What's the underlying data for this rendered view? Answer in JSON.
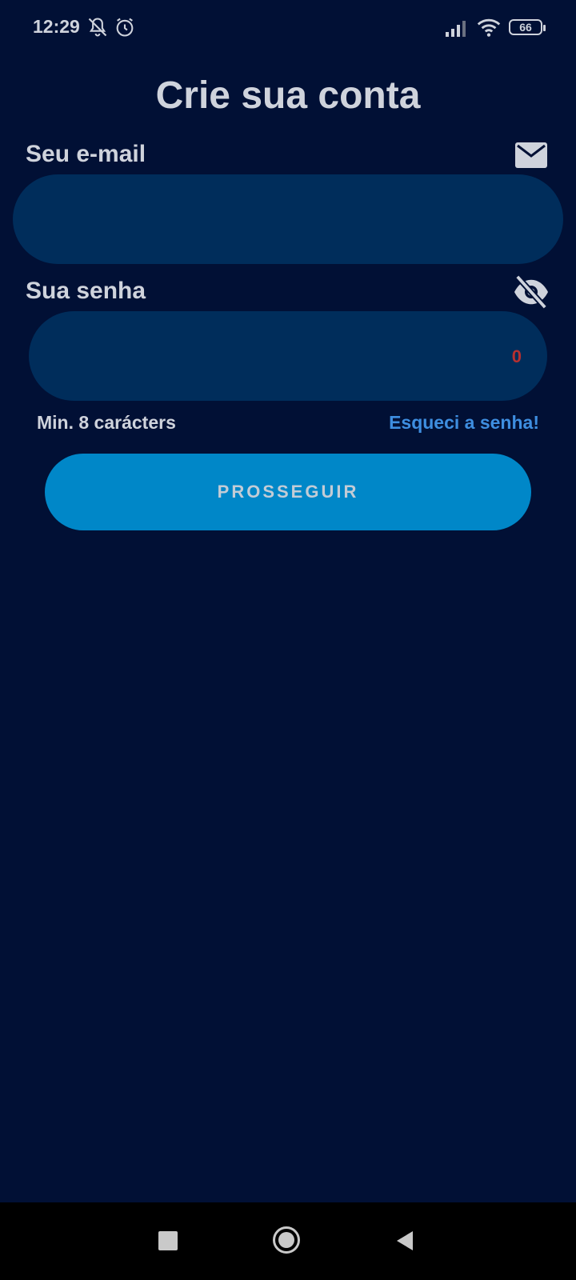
{
  "status_bar": {
    "time": "12:29",
    "battery": "66",
    "icons": [
      "bell-off-icon",
      "alarm-icon",
      "signal-icon",
      "wifi-icon",
      "battery-icon"
    ]
  },
  "page": {
    "title": "Crie sua conta"
  },
  "email": {
    "label": "Seu e-mail",
    "value": "",
    "icon": "mail-icon"
  },
  "password": {
    "label": "Sua senha",
    "value": "",
    "counter": "0",
    "icon": "eye-off-icon",
    "hint": "Min. 8 carácters",
    "forgot_link": "Esqueci a senha!"
  },
  "submit": {
    "label": "PROSSEGUIR"
  },
  "nav": {
    "icons": [
      "recent-apps-icon",
      "home-icon",
      "back-icon"
    ]
  },
  "colors": {
    "background": "#011035",
    "field": "#002d5b",
    "button": "#0087c8",
    "link": "#3e8ee0",
    "counter": "#b73030"
  }
}
